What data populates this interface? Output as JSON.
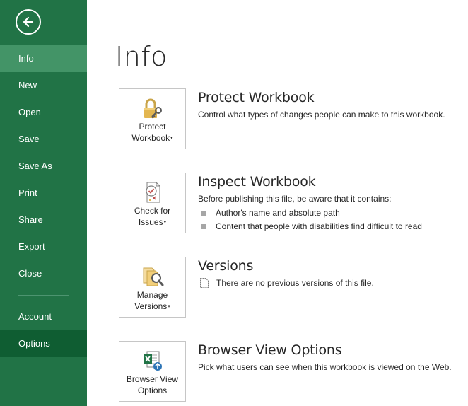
{
  "sidebar": {
    "items": [
      {
        "label": "Info"
      },
      {
        "label": "New"
      },
      {
        "label": "Open"
      },
      {
        "label": "Save"
      },
      {
        "label": "Save As"
      },
      {
        "label": "Print"
      },
      {
        "label": "Share"
      },
      {
        "label": "Export"
      },
      {
        "label": "Close"
      },
      {
        "label": "Account"
      },
      {
        "label": "Options"
      }
    ]
  },
  "main": {
    "title": "Info",
    "protect": {
      "tile_line1": "Protect",
      "tile_line2": "Workbook",
      "heading": "Protect Workbook",
      "desc": "Control what types of changes people can make to this workbook."
    },
    "inspect": {
      "tile_line1": "Check for",
      "tile_line2": "Issues",
      "heading": "Inspect Workbook",
      "desc": "Before publishing this file, be aware that it contains:",
      "bullets": [
        "Author's name and absolute path",
        "Content that people with disabilities find difficult to read"
      ]
    },
    "versions": {
      "tile_line1": "Manage",
      "tile_line2": "Versions",
      "heading": "Versions",
      "desc": "There are no previous versions of this file."
    },
    "browser": {
      "tile_line1": "Browser View",
      "tile_line2": "Options",
      "heading": "Browser View Options",
      "desc": "Pick what users can see when this workbook is viewed on the Web."
    }
  },
  "colors": {
    "sidebar_bg": "#217346",
    "active_item": "#439467",
    "selected_item": "#0f5d32"
  },
  "icons": {
    "back": "back-arrow-icon",
    "protect": "lock-key-icon",
    "inspect": "checklist-document-icon",
    "versions": "documents-magnifier-icon",
    "browser": "excel-web-icon",
    "version_doc": "blank-document-icon"
  }
}
